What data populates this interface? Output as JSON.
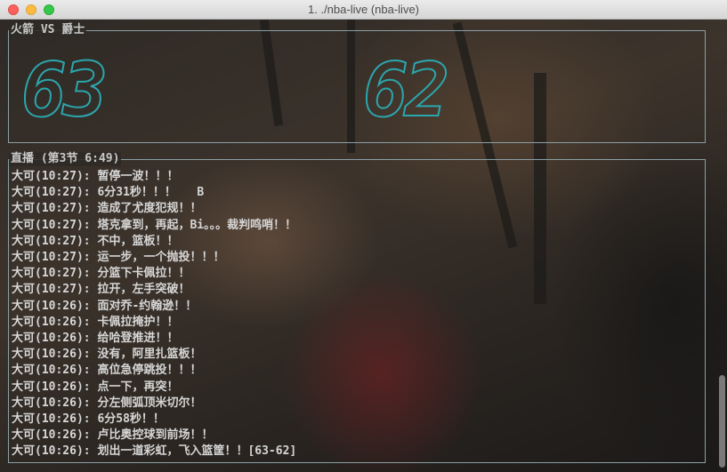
{
  "window": {
    "title": "1. ./nba-live (nba-live)"
  },
  "scoreboard": {
    "label": "火箭 VS 爵士",
    "home_score": "63",
    "away_score": "62"
  },
  "live": {
    "label": "直播 (第3节 6:49)",
    "lines": [
      "大可(10:27): 暂停一波！！！",
      "大可(10:27): 6分31秒！！！   B",
      "大可(10:27): 造成了尤度犯规！！",
      "大可(10:27): 塔克拿到，再起，Bi。。。裁判鸣哨！！",
      "大可(10:27): 不中，篮板！！",
      "大可(10:27): 运一步，一个抛投！！！",
      "大可(10:27): 分篮下卡佩拉！！",
      "大可(10:27): 拉开，左手突破！",
      "大可(10:26): 面对乔-约翰逊！！",
      "大可(10:26): 卡佩拉掩护！！",
      "大可(10:26): 给哈登推进！！",
      "大可(10:26): 没有，阿里扎篮板！",
      "大可(10:26): 高位急停跳投！！！",
      "大可(10:26): 点一下，再突！",
      "大可(10:26): 分左侧弧顶米切尔！",
      "大可(10:26): 6分58秒！！",
      "大可(10:26): 卢比奥控球到前场！！",
      "大可(10:26): 划出一道彩虹，飞入篮筐！！[63-62]"
    ]
  }
}
